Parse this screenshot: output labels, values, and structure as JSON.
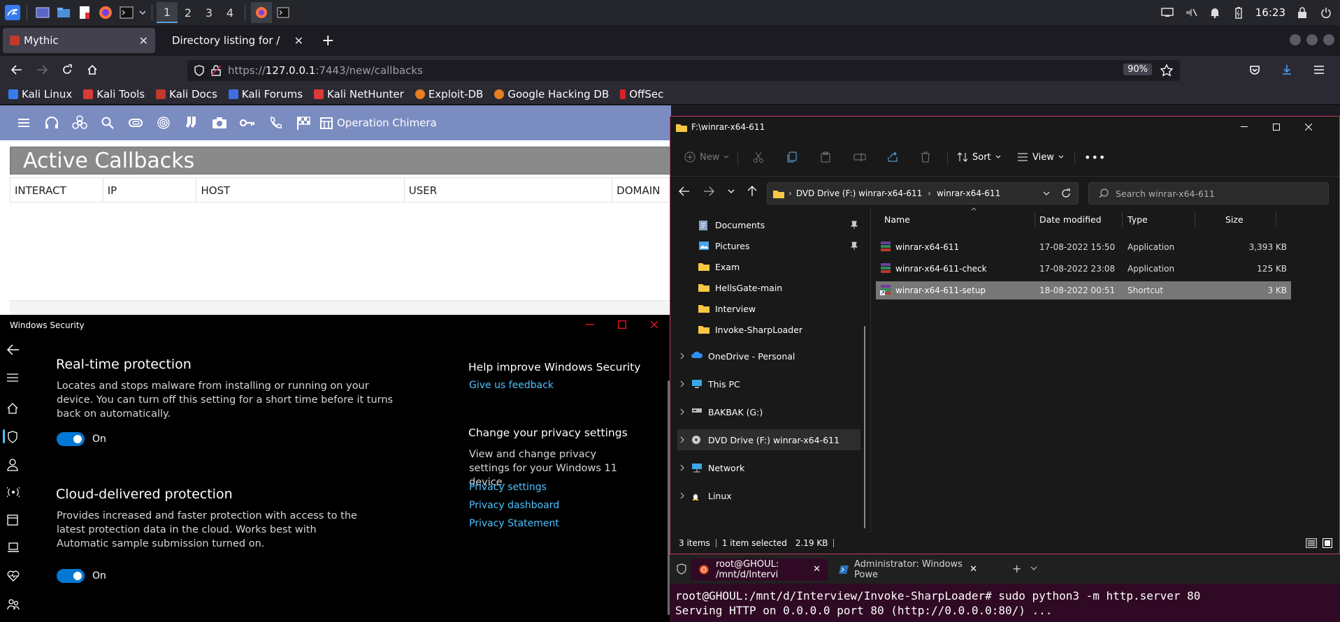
{
  "kali_panel": {
    "workspaces": [
      "1",
      "2",
      "3",
      "4"
    ],
    "clock": "16:23"
  },
  "firefox": {
    "tabs": [
      {
        "label": "Mythic",
        "active": true
      },
      {
        "label": "Directory listing for /",
        "active": false
      }
    ],
    "url_prefix": "https://",
    "url_host": "127.0.0.1",
    "url_rest": ":7443/new/callbacks",
    "zoom": "90%",
    "bookmarks": [
      "Kali Linux",
      "Kali Tools",
      "Kali Docs",
      "Kali Forums",
      "Kali NetHunter",
      "Exploit-DB",
      "Google Hacking DB",
      "OffSec"
    ]
  },
  "mythic": {
    "operation": "Operation Chimera",
    "page_title": "Active Callbacks",
    "columns": [
      "INTERACT",
      "IP",
      "HOST",
      "USER",
      "DOMAIN"
    ]
  },
  "windows_security": {
    "title": "Windows Security",
    "realtime": {
      "heading": "Real-time protection",
      "description": "Locates and stops malware from installing or running on your device. You can turn off this setting for a short time before it turns back on automatically.",
      "toggle_label": "On"
    },
    "cloud": {
      "heading": "Cloud-delivered protection",
      "description": "Provides increased and faster protection with access to the latest protection data in the cloud. Works best with Automatic sample submission turned on.",
      "toggle_label": "On"
    },
    "help": {
      "heading": "Help improve Windows Security",
      "link": "Give us feedback"
    },
    "privacy": {
      "heading": "Change your privacy settings",
      "description": "View and change privacy settings for your Windows 11 device.",
      "links": [
        "Privacy settings",
        "Privacy dashboard",
        "Privacy Statement"
      ]
    }
  },
  "explorer": {
    "title": "F:\\winrar-x64-611",
    "commands": {
      "new": "New",
      "sort": "Sort",
      "view": "View"
    },
    "breadcrumb": [
      "DVD Drive (F:) winrar-x64-611",
      "winrar-x64-611"
    ],
    "search_placeholder": "Search winrar-x64-611",
    "nav": [
      {
        "label": "Documents",
        "pinned": true
      },
      {
        "label": "Pictures",
        "pinned": true
      },
      {
        "label": "Exam"
      },
      {
        "label": "HellsGate-main"
      },
      {
        "label": "Interview"
      },
      {
        "label": "Invoke-SharpLoader"
      },
      {
        "label": "OneDrive - Personal"
      },
      {
        "label": "This PC"
      },
      {
        "label": "BAKBAK (G:)"
      },
      {
        "label": "DVD Drive (F:) winrar-x64-611"
      },
      {
        "label": "Network"
      },
      {
        "label": "Linux"
      }
    ],
    "columns": [
      "Name",
      "Date modified",
      "Type",
      "Size"
    ],
    "files": [
      {
        "name": "winrar-x64-611",
        "date": "17-08-2022 15:50",
        "type": "Application",
        "size": "3,393 KB"
      },
      {
        "name": "winrar-x64-611-check",
        "date": "17-08-2022 23:08",
        "type": "Application",
        "size": "125 KB"
      },
      {
        "name": "winrar-x64-611-setup",
        "date": "18-08-2022 00:51",
        "type": "Shortcut",
        "size": "3 KB"
      }
    ],
    "status": {
      "items": "3 items",
      "selected": "1 item selected",
      "size": "2.19 KB"
    }
  },
  "terminal": {
    "tabs": [
      "root@GHOUL: /mnt/d/Intervi",
      "Administrator: Windows Powe"
    ],
    "lines": [
      "root@GHOUL:/mnt/d/Interview/Invoke-SharpLoader# sudo python3 -m http.server 80",
      "Serving HTTP on 0.0.0.0 port 80 (http://0.0.0.0:80/) ..."
    ]
  }
}
